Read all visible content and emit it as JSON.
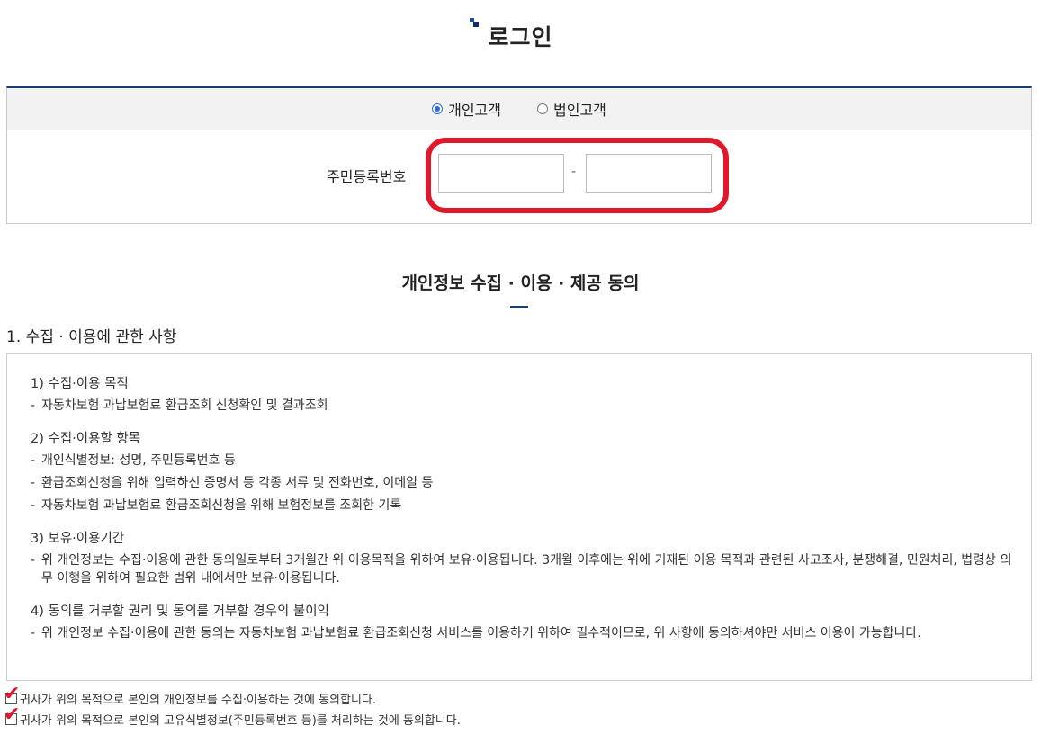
{
  "page": {
    "title": "로그인"
  },
  "customer_type": {
    "options": [
      {
        "label": "개인고객",
        "checked": true
      },
      {
        "label": "법인고객",
        "checked": false
      }
    ]
  },
  "rrn": {
    "label": "주민등록번호",
    "separator": "-",
    "first_value": "",
    "second_value": ""
  },
  "consent": {
    "title": "개인정보 수집 · 이용 · 제공 동의",
    "section_title": "1. 수집 · 이용에 관한 사항",
    "groups": [
      {
        "heading": "1) 수집·이용 목적",
        "items": [
          "자동차보험 과납보험료 환급조회 신청확인 및 결과조회"
        ]
      },
      {
        "heading": "2) 수집·이용할 항목",
        "items": [
          "개인식별정보: 성명, 주민등록번호 등",
          "환급조회신청을 위해 입력하신 증명서 등 각종 서류 및 전화번호, 이메일 등",
          "자동차보험 과납보험료 환급조회신청을 위해 보험정보를 조회한 기록"
        ]
      },
      {
        "heading": "3) 보유·이용기간",
        "items": [
          "위 개인정보는 수집·이용에 관한 동의일로부터 3개월간 위 이용목적을 위하여 보유·이용됩니다. 3개월 이후에는 위에 기재된 이용 목적과 관련된 사고조사, 분쟁해결, 민원처리, 법령상 의무 이행을 위하여 필요한 범위 내에서만 보유·이용됩니다."
        ]
      },
      {
        "heading": "4) 동의를 거부할 권리 및 동의를 거부할 경우의 불이익",
        "items": [
          "위 개인정보 수집·이용에 관한 동의는 자동차보험 과납보험료 환급조회신청 서비스를 이용하기 위하여 필수적이므로, 위 사항에 동의하셔야만 서비스 이용이 가능합니다."
        ]
      }
    ],
    "checks": [
      {
        "label": "귀사가 위의 목적으로 본인의 개인정보를 수집·이용하는 것에 동의합니다.",
        "checked": true
      },
      {
        "label": "귀사가 위의 목적으로 본인의 고유식별정보(주민등록번호 등)를 처리하는 것에 동의합니다.",
        "checked": true
      }
    ]
  },
  "colors": {
    "accent": "#1a3e7a",
    "highlight": "#e0182b",
    "radio": "#2a6cd6"
  }
}
